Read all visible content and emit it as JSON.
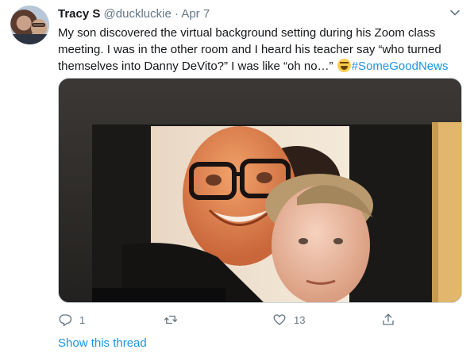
{
  "tweet": {
    "author_name": "Tracy S",
    "author_handle": "@duckluckie",
    "separator": "·",
    "date": "Apr 7",
    "text_main": "My son discovered the virtual background setting during his Zoom class meeting. I was in the other room and I heard his teacher say “who turned themselves into Danny DeVito?” I was like “oh no…”",
    "emoji": "grinning-squinting-face",
    "hashtag": "#SomeGoodNews",
    "media_description_icon": "photo",
    "reply_count": "1",
    "retweet_count": "",
    "like_count": "13",
    "show_thread_label": "Show this thread"
  },
  "icons": {
    "reply": "reply-icon",
    "retweet": "retweet-icon",
    "like": "like-icon",
    "share": "share-icon",
    "more": "chevron-down-icon"
  },
  "colors": {
    "link": "#1b95e0",
    "secondary_text": "#657786",
    "primary_text": "#14171a"
  }
}
